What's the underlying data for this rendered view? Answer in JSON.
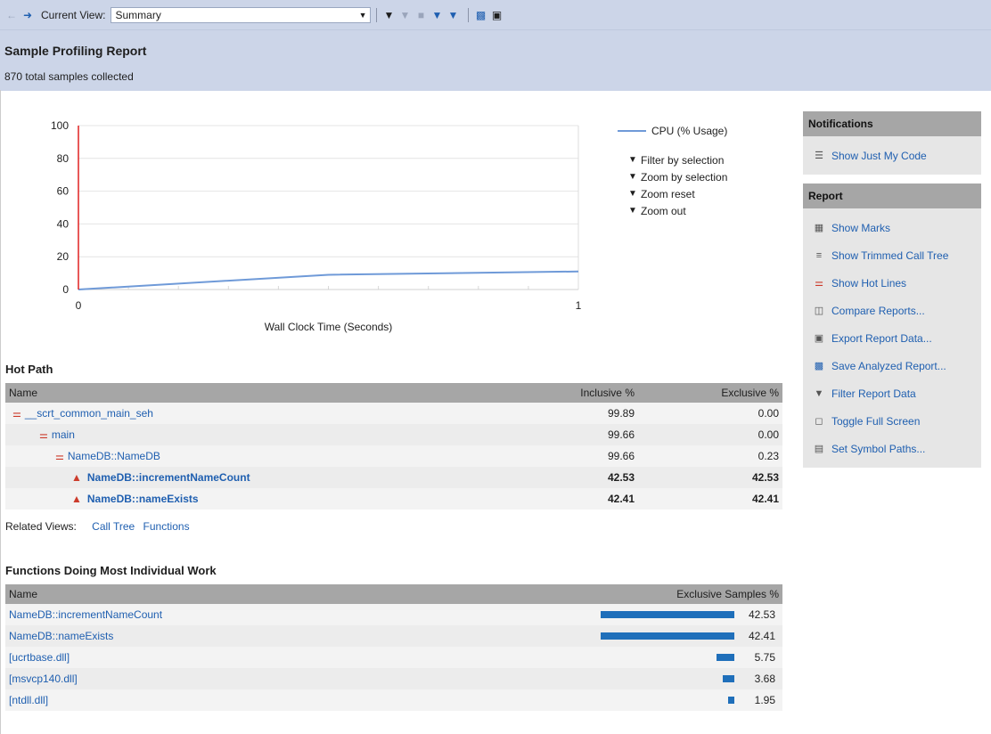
{
  "toolbar": {
    "back_icon": "back-arrow-icon",
    "forward_icon": "forward-arrow-icon",
    "view_label": "Current View:",
    "view_value": "Summary"
  },
  "header": {
    "title": "Sample Profiling Report",
    "subtitle": "870 total samples collected"
  },
  "chart_data": {
    "type": "line",
    "title": "",
    "xlabel": "Wall Clock Time (Seconds)",
    "ylabel": "",
    "xlim": [
      0,
      1
    ],
    "ylim": [
      0,
      100
    ],
    "x_ticks": [
      "0",
      "1"
    ],
    "y_ticks": [
      "100",
      "80",
      "60",
      "40",
      "20",
      "0"
    ],
    "series": [
      {
        "name": "CPU (% Usage)",
        "x": [
          0,
          0.5,
          1
        ],
        "y": [
          0,
          9,
          11
        ],
        "color": "#6f9ad8"
      }
    ],
    "marker_x": 0,
    "marker_color": "#e02020",
    "legend_position": "right",
    "grid": true
  },
  "legend": {
    "series_label": "CPU (% Usage)",
    "commands": [
      {
        "label": "Filter by selection",
        "icon": "filter-selection-icon"
      },
      {
        "label": "Zoom by selection",
        "icon": "zoom-filter-icon"
      },
      {
        "label": "Zoom reset",
        "icon": "zoom-reset-icon"
      },
      {
        "label": "Zoom out",
        "icon": "zoom-out-icon"
      }
    ]
  },
  "notifications": {
    "title": "Notifications",
    "items": [
      {
        "label": "Show Just My Code",
        "icon": "just-my-code-icon"
      }
    ]
  },
  "report": {
    "title": "Report",
    "items": [
      {
        "label": "Show Marks",
        "icon": "marks-icon"
      },
      {
        "label": "Show Trimmed Call Tree",
        "icon": "call-tree-icon"
      },
      {
        "label": "Show Hot Lines",
        "icon": "hot-lines-icon"
      },
      {
        "label": "Compare Reports...",
        "icon": "compare-icon"
      },
      {
        "label": "Export Report Data...",
        "icon": "export-icon"
      },
      {
        "label": "Save Analyzed Report...",
        "icon": "save-icon"
      },
      {
        "label": "Filter Report Data",
        "icon": "filter-icon"
      },
      {
        "label": "Toggle Full Screen",
        "icon": "fullscreen-icon"
      },
      {
        "label": "Set Symbol Paths...",
        "icon": "symbol-paths-icon"
      }
    ]
  },
  "hot_path": {
    "title": "Hot Path",
    "columns": [
      "Name",
      "Inclusive %",
      "Exclusive %"
    ],
    "rows": [
      {
        "name": "__scrt_common_main_seh",
        "inclusive": "99.89",
        "exclusive": "0.00",
        "indent": 0,
        "hot": false
      },
      {
        "name": "main",
        "inclusive": "99.66",
        "exclusive": "0.00",
        "indent": 1,
        "hot": false
      },
      {
        "name": "NameDB::NameDB",
        "inclusive": "99.66",
        "exclusive": "0.23",
        "indent": 2,
        "hot": false
      },
      {
        "name": "NameDB::incrementNameCount",
        "inclusive": "42.53",
        "exclusive": "42.53",
        "indent": 3,
        "hot": true
      },
      {
        "name": "NameDB::nameExists",
        "inclusive": "42.41",
        "exclusive": "42.41",
        "indent": 3,
        "hot": true
      }
    ]
  },
  "related_views": {
    "label": "Related Views:",
    "links": [
      "Call Tree",
      "Functions"
    ]
  },
  "functions": {
    "title": "Functions Doing Most Individual Work",
    "columns": [
      "Name",
      "Exclusive Samples %"
    ],
    "rows": [
      {
        "name": "NameDB::incrementNameCount",
        "value": "42.53",
        "pct": 42.53
      },
      {
        "name": "NameDB::nameExists",
        "value": "42.41",
        "pct": 42.41
      },
      {
        "name": "[ucrtbase.dll]",
        "value": "5.75",
        "pct": 5.75
      },
      {
        "name": "[msvcp140.dll]",
        "value": "3.68",
        "pct": 3.68
      },
      {
        "name": "[ntdll.dll]",
        "value": "1.95",
        "pct": 1.95
      }
    ]
  }
}
